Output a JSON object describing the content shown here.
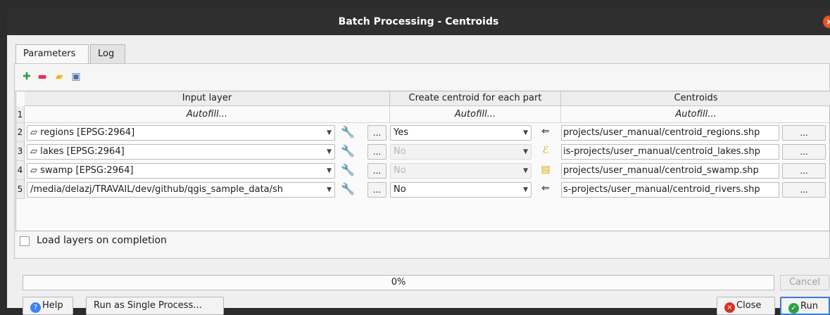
{
  "window": {
    "title": "Batch Processing - Centroids"
  },
  "tabs": [
    {
      "label": "Parameters"
    },
    {
      "label": "Log"
    }
  ],
  "toolbar": {
    "icons": [
      "add-row-icon",
      "remove-row-icon",
      "open-file-icon",
      "save-icon"
    ]
  },
  "table": {
    "headers": [
      "Input layer",
      "Create centroid for each part",
      "Centroids"
    ],
    "autofill_row": {
      "number": "1",
      "input": "Autofill...",
      "create": "Autofill...",
      "output": "Autofill..."
    },
    "rows": [
      {
        "number": "2",
        "input": "regions [EPSG:2964]",
        "create": "Yes",
        "output": "projects/user_manual/centroid_regions.shp",
        "ellipsis": "...",
        "create_disabled": false
      },
      {
        "number": "3",
        "input": "lakes [EPSG:2964]",
        "create": "No",
        "output": "is-projects/user_manual/centroid_lakes.shp",
        "ellipsis": "...",
        "create_disabled": true
      },
      {
        "number": "4",
        "input": "swamp [EPSG:2964]",
        "create": "No",
        "output": "projects/user_manual/centroid_swamp.shp",
        "ellipsis": "...",
        "create_disabled": true
      },
      {
        "number": "5",
        "input": "/media/delazj/TRAVAIL/dev/github/qgis_sample_data/sh",
        "create": "No",
        "output": "s-projects/user_manual/centroid_rivers.shp",
        "ellipsis": "...",
        "create_disabled": false
      }
    ]
  },
  "options": {
    "load_layers_label": "Load layers on completion",
    "load_layers_checked": false
  },
  "progress": {
    "value": 0,
    "label": "0%"
  },
  "buttons": {
    "cancel": "Cancel",
    "help": "Help",
    "run_single": "Run as Single Process...",
    "close": "Close",
    "run": "Run"
  },
  "colors": {
    "accent_orange": "#e95420",
    "help_blue": "#3b82f6",
    "run_green": "#2ea043",
    "close_red": "#d93025"
  }
}
